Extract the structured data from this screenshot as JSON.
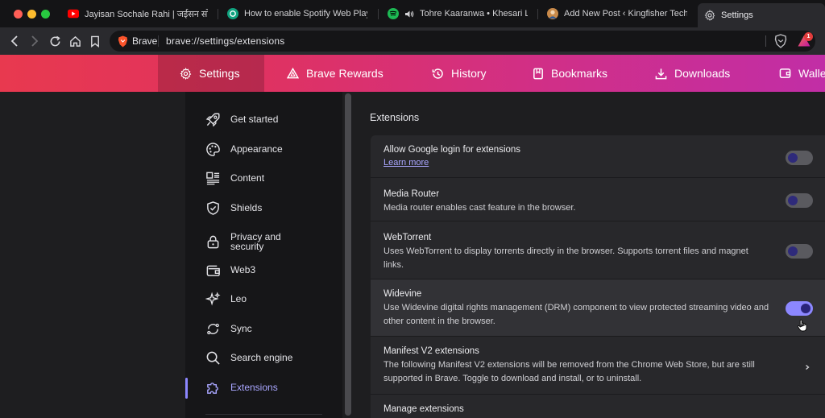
{
  "tabs": [
    {
      "title": "Jayisan Sochale Rahi | जईसन सोचले",
      "favicon": "youtube-icon",
      "color": "#ff0000"
    },
    {
      "title": "How to enable Spotify Web Player",
      "favicon": "chatgpt-icon",
      "color": "#10a37f"
    },
    {
      "title": "Tohre Kaaranwa • Khesari Lal",
      "favicon": "spotify-icon",
      "color": "#1db954"
    },
    {
      "title": "Add New Post ‹ Kingfisher Tech T",
      "favicon": "avatar-icon",
      "color": "#c98a4a"
    },
    {
      "title": "Settings",
      "favicon": "gear-icon",
      "color": "#d0d0d4"
    }
  ],
  "toolbar": {
    "brand": "Brave",
    "url": "brave://settings/extensions",
    "rewards_badge": "1"
  },
  "settings_nav": [
    {
      "label": "Settings",
      "icon": "gear-icon"
    },
    {
      "label": "Brave Rewards",
      "icon": "rewards-triangle-icon"
    },
    {
      "label": "History",
      "icon": "history-icon"
    },
    {
      "label": "Bookmarks",
      "icon": "bookmark-icon"
    },
    {
      "label": "Downloads",
      "icon": "download-icon"
    },
    {
      "label": "Walle",
      "icon": "wallet-icon"
    }
  ],
  "sidebar": {
    "items": [
      {
        "label": "Get started",
        "icon": "rocket-icon"
      },
      {
        "label": "Appearance",
        "icon": "palette-icon"
      },
      {
        "label": "Content",
        "icon": "content-icon"
      },
      {
        "label": "Shields",
        "icon": "shield-icon"
      },
      {
        "label": "Privacy and\nsecurity",
        "icon": "lock-icon"
      },
      {
        "label": "Web3",
        "icon": "wallet-icon"
      },
      {
        "label": "Leo",
        "icon": "sparkle-icon"
      },
      {
        "label": "Sync",
        "icon": "sync-icon"
      },
      {
        "label": "Search engine",
        "icon": "search-icon"
      },
      {
        "label": "Extensions",
        "icon": "puzzle-icon"
      }
    ],
    "active": "Extensions"
  },
  "main": {
    "section_title": "Extensions",
    "rows": [
      {
        "title": "Allow Google login for extensions",
        "link": "Learn more",
        "toggle": false
      },
      {
        "title": "Media Router",
        "desc": "Media router enables cast feature in the browser.",
        "toggle": false
      },
      {
        "title": "WebTorrent",
        "desc": "Uses WebTorrent to display torrents directly in the browser. Supports torrent files and magnet links.",
        "toggle": false
      },
      {
        "title": "Widevine",
        "desc": "Use Widevine digital rights management (DRM) component to view protected streaming video and other content in the browser.",
        "toggle": true
      },
      {
        "title": "Manifest V2 extensions",
        "desc": "The following Manifest V2 extensions will be removed from the Chrome Web Store, but are still supported in Brave. Toggle to download and install, or to uninstall."
      },
      {
        "title": "Manage extensions"
      }
    ]
  },
  "colors": {
    "accent": "#8c87ff",
    "nav_gradient_start": "#e8394f",
    "nav_gradient_end": "#c12ea6"
  }
}
